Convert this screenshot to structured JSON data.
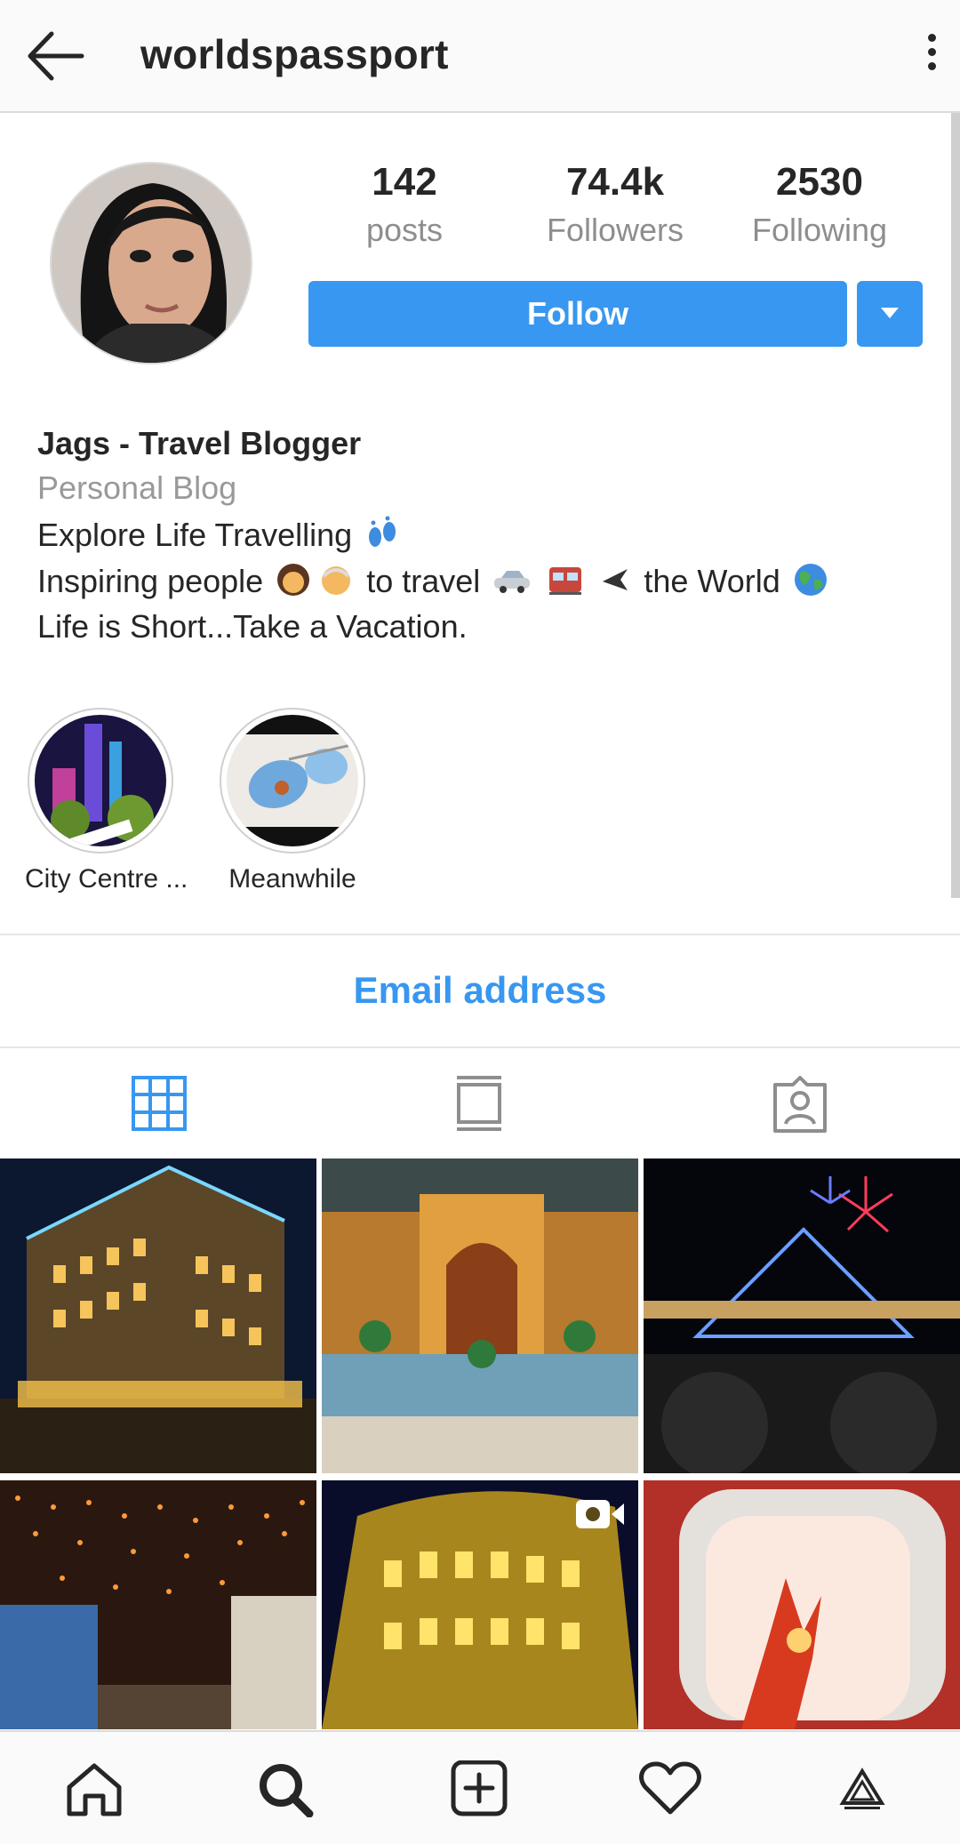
{
  "header": {
    "username": "worldspassport",
    "back_icon": "arrow-left-icon",
    "menu_icon": "more-vertical-icon"
  },
  "stats": [
    {
      "value": "142",
      "label": "posts"
    },
    {
      "value": "74.4k",
      "label": "Followers"
    },
    {
      "value": "2530",
      "label": "Following"
    }
  ],
  "actions": {
    "follow_label": "Follow",
    "dropdown_icon": "caret-down-icon"
  },
  "bio": {
    "name": "Jags - Travel Blogger",
    "category": "Personal Blog",
    "line1": "Explore Life Travelling",
    "line2_a": "Inspiring people",
    "line2_b": "to travel",
    "line2_c": "the World",
    "line3": "Life is Short...Take a Vacation."
  },
  "highlights": [
    {
      "label": "City Centre ..."
    },
    {
      "label": "Meanwhile"
    }
  ],
  "email_link": "Email address",
  "tabs": [
    {
      "icon": "grid-icon",
      "active": true
    },
    {
      "icon": "feed-icon",
      "active": false
    },
    {
      "icon": "tagged-icon",
      "active": false
    }
  ],
  "bottom_nav": [
    {
      "icon": "home-icon"
    },
    {
      "icon": "search-icon"
    },
    {
      "icon": "add-post-icon"
    },
    {
      "icon": "heart-icon"
    },
    {
      "icon": "profile-logo-icon"
    }
  ],
  "colors": {
    "accent": "#3897f0",
    "text": "#262626",
    "muted": "#8e8e8e"
  }
}
